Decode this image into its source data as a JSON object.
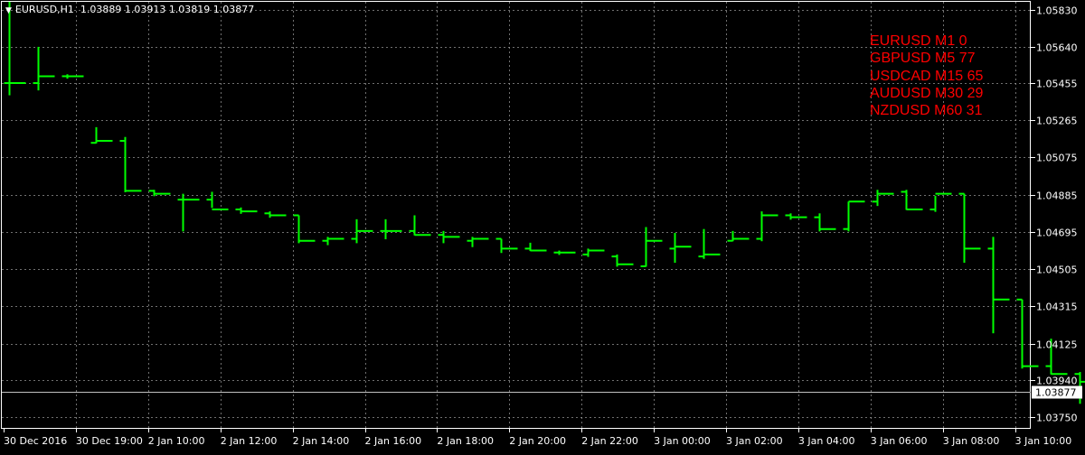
{
  "header": {
    "symbol_timeframe": "EURUSD,H1",
    "ohlc": "1.03889 1.03913 1.03819 1.03877"
  },
  "signals": [
    "EURUSD M1 0",
    "GBPUSD M5 77",
    "USDCAD M15 65",
    "AUDUSD M30 29",
    "NZDUSD M60 31"
  ],
  "colors": {
    "background": "#000000",
    "bars": "#00ff00",
    "grid": "#a0a0a0",
    "text": "#ffffff",
    "signals": "#ff0000",
    "current_price_line": "#c0c0c0"
  },
  "chart_data": {
    "type": "ohlc",
    "ylim": [
      1.0369,
      1.0587
    ],
    "y_ticks": [
      "1.05830",
      "1.05640",
      "1.05455",
      "1.05265",
      "1.05075",
      "1.04885",
      "1.04695",
      "1.04505",
      "1.04315",
      "1.04125",
      "1.03940",
      "1.03750"
    ],
    "x_tick_labels": [
      "30 Dec 2016",
      "30 Dec 19:00",
      "2 Jan 10:00",
      "2 Jan 12:00",
      "2 Jan 14:00",
      "2 Jan 16:00",
      "2 Jan 18:00",
      "2 Jan 20:00",
      "2 Jan 22:00",
      "3 Jan 00:00",
      "3 Jan 02:00",
      "3 Jan 04:00",
      "3 Jan 06:00",
      "3 Jan 08:00",
      "3 Jan 10:00"
    ],
    "current_price": "1.03877",
    "bars": [
      [
        1.05455,
        1.0587,
        1.05395,
        1.05455
      ],
      [
        1.05455,
        1.0564,
        1.0542,
        1.0549
      ],
      [
        1.0549,
        1.055,
        1.0548,
        1.0549
      ],
      [
        1.0515,
        1.0523,
        1.0515,
        1.0516
      ],
      [
        1.0516,
        1.0518,
        1.049,
        1.04905
      ],
      [
        1.04905,
        1.0491,
        1.0488,
        1.0489
      ],
      [
        1.0486,
        1.0489,
        1.047,
        1.0486
      ],
      [
        1.0486,
        1.049,
        1.0482,
        1.0481
      ],
      [
        1.0481,
        1.0482,
        1.0479,
        1.048
      ],
      [
        1.0479,
        1.048,
        1.0477,
        1.0478
      ],
      [
        1.0478,
        1.0478,
        1.0464,
        1.0465
      ],
      [
        1.0465,
        1.0467,
        1.0463,
        1.0466
      ],
      [
        1.0466,
        1.0476,
        1.0464,
        1.047
      ],
      [
        1.047,
        1.0476,
        1.0466,
        1.047
      ],
      [
        1.047,
        1.0478,
        1.0468,
        1.0468
      ],
      [
        1.0468,
        1.047,
        1.0464,
        1.0467
      ],
      [
        1.0465,
        1.0467,
        1.0462,
        1.0466
      ],
      [
        1.0466,
        1.0466,
        1.0459,
        1.0461
      ],
      [
        1.0461,
        1.0464,
        1.046,
        1.046
      ],
      [
        1.0459,
        1.046,
        1.0458,
        1.0459
      ],
      [
        1.0458,
        1.0461,
        1.0457,
        1.046
      ],
      [
        1.0457,
        1.0458,
        1.0452,
        1.0453
      ],
      [
        1.0452,
        1.0472,
        1.0452,
        1.0465
      ],
      [
        1.0461,
        1.0469,
        1.0454,
        1.0462
      ],
      [
        1.0457,
        1.0471,
        1.0456,
        1.0458
      ],
      [
        1.0465,
        1.047,
        1.0465,
        1.0466
      ],
      [
        1.0466,
        1.048,
        1.0465,
        1.0478
      ],
      [
        1.0478,
        1.0479,
        1.0476,
        1.0477
      ],
      [
        1.0477,
        1.0479,
        1.047,
        1.0471
      ],
      [
        1.0471,
        1.0485,
        1.047,
        1.0485
      ],
      [
        1.0485,
        1.0491,
        1.0483,
        1.0489
      ],
      [
        1.049,
        1.0491,
        1.0481,
        1.0481
      ],
      [
        1.0481,
        1.0488,
        1.048,
        1.0489
      ],
      [
        1.0489,
        1.0489,
        1.0454,
        1.0461
      ],
      [
        1.0461,
        1.0467,
        1.0418,
        1.0435
      ],
      [
        1.0435,
        1.0435,
        1.04,
        1.0401
      ],
      [
        1.0401,
        1.0415,
        1.0397,
        1.0397
      ],
      [
        1.0397,
        1.0398,
        1.0382,
        1.0393
      ],
      [
        1.0391,
        1.0393,
        1.0377,
        1.0388
      ],
      [
        1.0388,
        1.0391,
        1.0382,
        1.03877
      ]
    ]
  }
}
